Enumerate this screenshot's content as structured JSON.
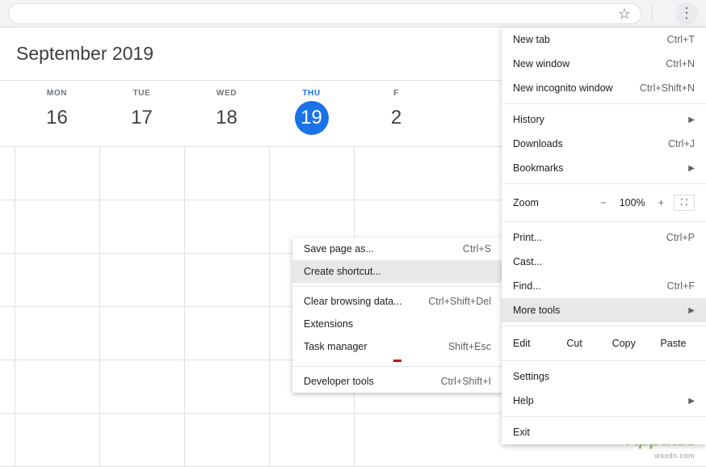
{
  "header": {
    "title": "September 2019"
  },
  "days": [
    {
      "dow": "MON",
      "num": "16",
      "today": false
    },
    {
      "dow": "TUE",
      "num": "17",
      "today": false
    },
    {
      "dow": "WED",
      "num": "18",
      "today": false
    },
    {
      "dow": "THU",
      "num": "19",
      "today": true
    },
    {
      "dow": "F",
      "num": "2",
      "today": false
    }
  ],
  "mainMenu": {
    "newTab": {
      "label": "New tab",
      "shortcut": "Ctrl+T"
    },
    "newWindow": {
      "label": "New window",
      "shortcut": "Ctrl+N"
    },
    "newIncognito": {
      "label": "New incognito window",
      "shortcut": "Ctrl+Shift+N"
    },
    "history": {
      "label": "History"
    },
    "downloads": {
      "label": "Downloads",
      "shortcut": "Ctrl+J"
    },
    "bookmarks": {
      "label": "Bookmarks"
    },
    "zoom": {
      "label": "Zoom",
      "value": "100%",
      "minus": "−",
      "plus": "+"
    },
    "print": {
      "label": "Print...",
      "shortcut": "Ctrl+P"
    },
    "cast": {
      "label": "Cast..."
    },
    "find": {
      "label": "Find...",
      "shortcut": "Ctrl+F"
    },
    "moreTools": {
      "label": "More tools"
    },
    "edit": {
      "label": "Edit",
      "cut": "Cut",
      "copy": "Copy",
      "paste": "Paste"
    },
    "settings": {
      "label": "Settings"
    },
    "help": {
      "label": "Help"
    },
    "exit": {
      "label": "Exit"
    }
  },
  "subMenu": {
    "savePage": {
      "label": "Save page as...",
      "shortcut": "Ctrl+S"
    },
    "createShortcut": {
      "label": "Create shortcut..."
    },
    "clearBrowsing": {
      "label": "Clear browsing data...",
      "shortcut": "Ctrl+Shift+Del"
    },
    "extensions": {
      "label": "Extensions"
    },
    "taskManager": {
      "label": "Task manager",
      "shortcut": "Shift+Esc"
    },
    "devTools": {
      "label": "Developer tools",
      "shortcut": "Ctrl+Shift+I"
    }
  },
  "watermark": {
    "main": "Appuals",
    "sub": "wsxdn.com"
  }
}
